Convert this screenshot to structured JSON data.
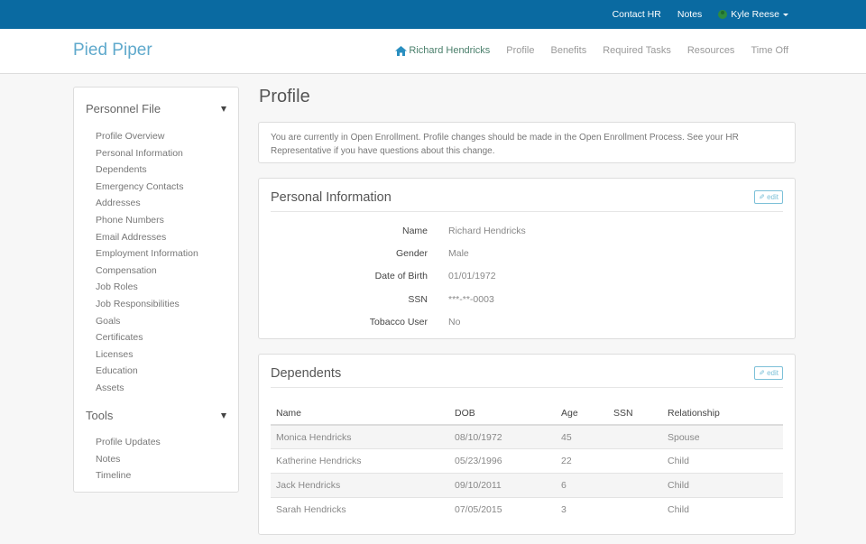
{
  "topbar": {
    "links": [
      "Contact HR",
      "Notes"
    ],
    "user": {
      "name": "Kyle Reese",
      "icon": "user-avatar-icon"
    },
    "color": "#0a6aa1"
  },
  "header": {
    "brand": "Pied Piper",
    "nav": {
      "home": {
        "label": "Richard Hendricks",
        "icon": "home-icon"
      },
      "items": [
        "Profile",
        "Benefits",
        "Required Tasks",
        "Resources",
        "Time Off"
      ]
    }
  },
  "sidebar": {
    "sections": [
      {
        "title": "Personnel File",
        "items": [
          "Profile Overview",
          "Personal Information",
          "Dependents",
          "Emergency Contacts",
          "Addresses",
          "Phone Numbers",
          "Email Addresses",
          "Employment Information",
          "Compensation",
          "Job Roles",
          "Job Responsibilities",
          "Goals",
          "Certificates",
          "Licenses",
          "Education",
          "Assets"
        ]
      },
      {
        "title": "Tools",
        "items": [
          "Profile Updates",
          "Notes",
          "Timeline"
        ]
      }
    ]
  },
  "main": {
    "title": "Profile",
    "notice": "You are currently in Open Enrollment. Profile changes should be made in the Open Enrollment Process. See your HR Representative if you have questions about this change.",
    "personal_info": {
      "title": "Personal Information",
      "edit_label": "edit",
      "fields": [
        {
          "label": "Name",
          "value": "Richard Hendricks"
        },
        {
          "label": "Gender",
          "value": "Male"
        },
        {
          "label": "Date of Birth",
          "value": "01/01/1972"
        },
        {
          "label": "SSN",
          "value": "***-**-0003"
        },
        {
          "label": "Tobacco User",
          "value": "No"
        }
      ]
    },
    "dependents": {
      "title": "Dependents",
      "edit_label": "edit",
      "columns": [
        "Name",
        "DOB",
        "Age",
        "SSN",
        "Relationship"
      ],
      "rows": [
        [
          "Monica Hendricks",
          "08/10/1972",
          "45",
          "",
          "Spouse"
        ],
        [
          "Katherine Hendricks",
          "05/23/1996",
          "22",
          "",
          "Child"
        ],
        [
          "Jack Hendricks",
          "09/10/2011",
          "6",
          "",
          "Child"
        ],
        [
          "Sarah Hendricks",
          "07/05/2015",
          "3",
          "",
          "Child"
        ]
      ]
    }
  }
}
